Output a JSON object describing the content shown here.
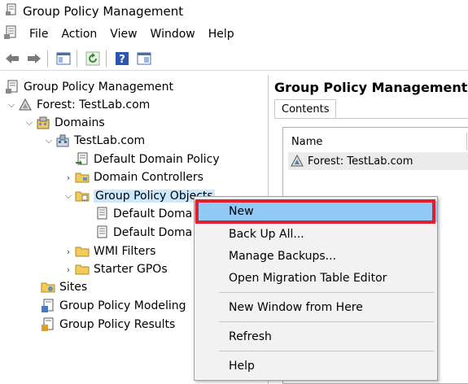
{
  "window": {
    "title": "Group Policy Management"
  },
  "menu": {
    "items": [
      "File",
      "Action",
      "View",
      "Window",
      "Help"
    ]
  },
  "toolbar": {
    "buttons": [
      "back-arrow-icon",
      "forward-arrow-icon",
      "show-hide-tree-icon",
      "refresh-icon",
      "help-icon",
      "properties-icon"
    ]
  },
  "tree": {
    "root": "Group Policy Management",
    "forest": "Forest: TestLab.com",
    "domains": "Domains",
    "domain": "TestLab.com",
    "default_domain_policy": "Default Domain Policy",
    "domain_controllers": "Domain Controllers",
    "gpo": "Group Policy Objects",
    "gpo_child_1": "Default Doma",
    "gpo_child_2": "Default Doma",
    "wmi_filters": "WMI Filters",
    "starter_gpos": "Starter GPOs",
    "sites": "Sites",
    "modeling": "Group Policy Modeling",
    "results": "Group Policy Results"
  },
  "details": {
    "title": "Group Policy Management",
    "tab": "Contents",
    "column_name": "Name",
    "rows": [
      "Forest: TestLab.com"
    ]
  },
  "context_menu": {
    "new": "New",
    "back_up_all": "Back Up All...",
    "manage_backups": "Manage Backups...",
    "open_migration": "Open Migration Table Editor",
    "new_window": "New Window from Here",
    "refresh": "Refresh",
    "help": "Help"
  },
  "colors": {
    "highlight": "#91c9f7",
    "selection": "#cce8ff",
    "callout": "#e0202e"
  }
}
